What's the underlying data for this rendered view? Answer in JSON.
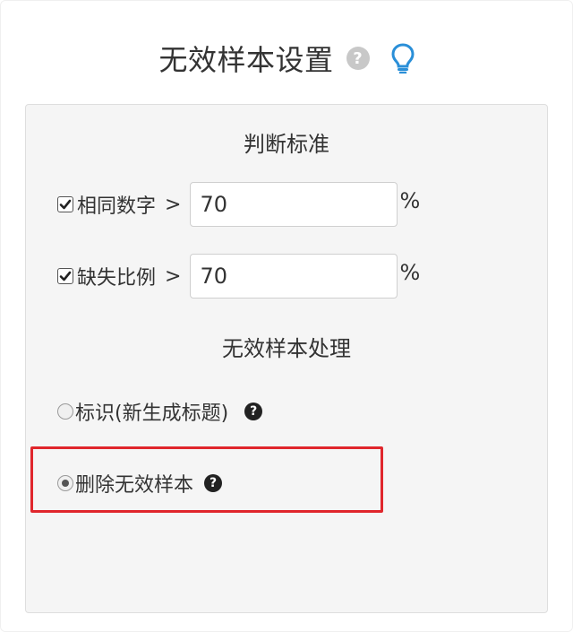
{
  "header": {
    "title": "无效样本设置",
    "help_icon": "question-circle-icon",
    "hint_icon": "lightbulb-icon"
  },
  "criteria": {
    "section_title": "判断标准",
    "items": [
      {
        "label": "相同数字",
        "operator": ">",
        "value": "70",
        "unit": "%",
        "checked": true
      },
      {
        "label": "缺失比例",
        "operator": ">",
        "value": "70",
        "unit": "%",
        "checked": true
      }
    ]
  },
  "handling": {
    "section_title": "无效样本处理",
    "options": [
      {
        "label": "标识(新生成标题)",
        "selected": false,
        "help_icon": "question-circle-icon"
      },
      {
        "label": "删除无效样本",
        "selected": true,
        "help_icon": "question-circle-icon"
      }
    ]
  },
  "colors": {
    "highlight": "#e0262c",
    "bulb": "#2a8fd8",
    "panel_bg": "#f5f5f5"
  }
}
